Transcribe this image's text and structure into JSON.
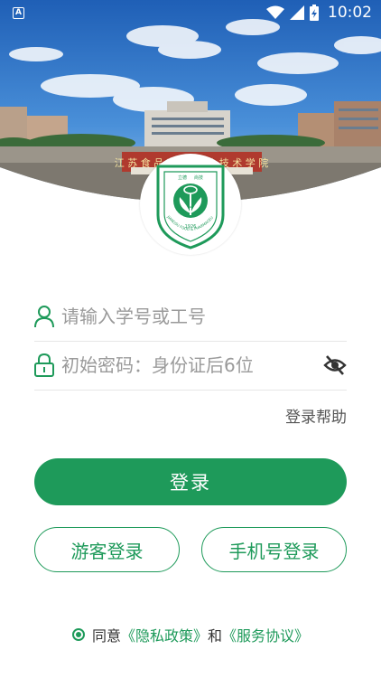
{
  "status_bar": {
    "time": "10:02",
    "app_icon_letter": "A"
  },
  "school_gate_sign": "江 苏 食 品 药 品 职 业 技 术 学 院",
  "logo": {
    "motto_left": "立德",
    "motto_right": "尚技",
    "year": "1926",
    "english_name": "JIANGSU FOOD & PHARMACEUTICAL SCIENCE COLLEGE"
  },
  "form": {
    "account_placeholder": "请输入学号或工号",
    "password_placeholder": "初始密码：身份证后6位",
    "help_link": "登录帮助",
    "login_button": "登录",
    "guest_button": "游客登录",
    "phone_button": "手机号登录"
  },
  "agreement": {
    "agree_text": "同意",
    "privacy_link": "《隐私政策》",
    "and_text": "和",
    "service_link": "《服务协议》"
  },
  "colors": {
    "brand_green": "#1e9a5a",
    "sky_blue": "#2f74c8"
  }
}
